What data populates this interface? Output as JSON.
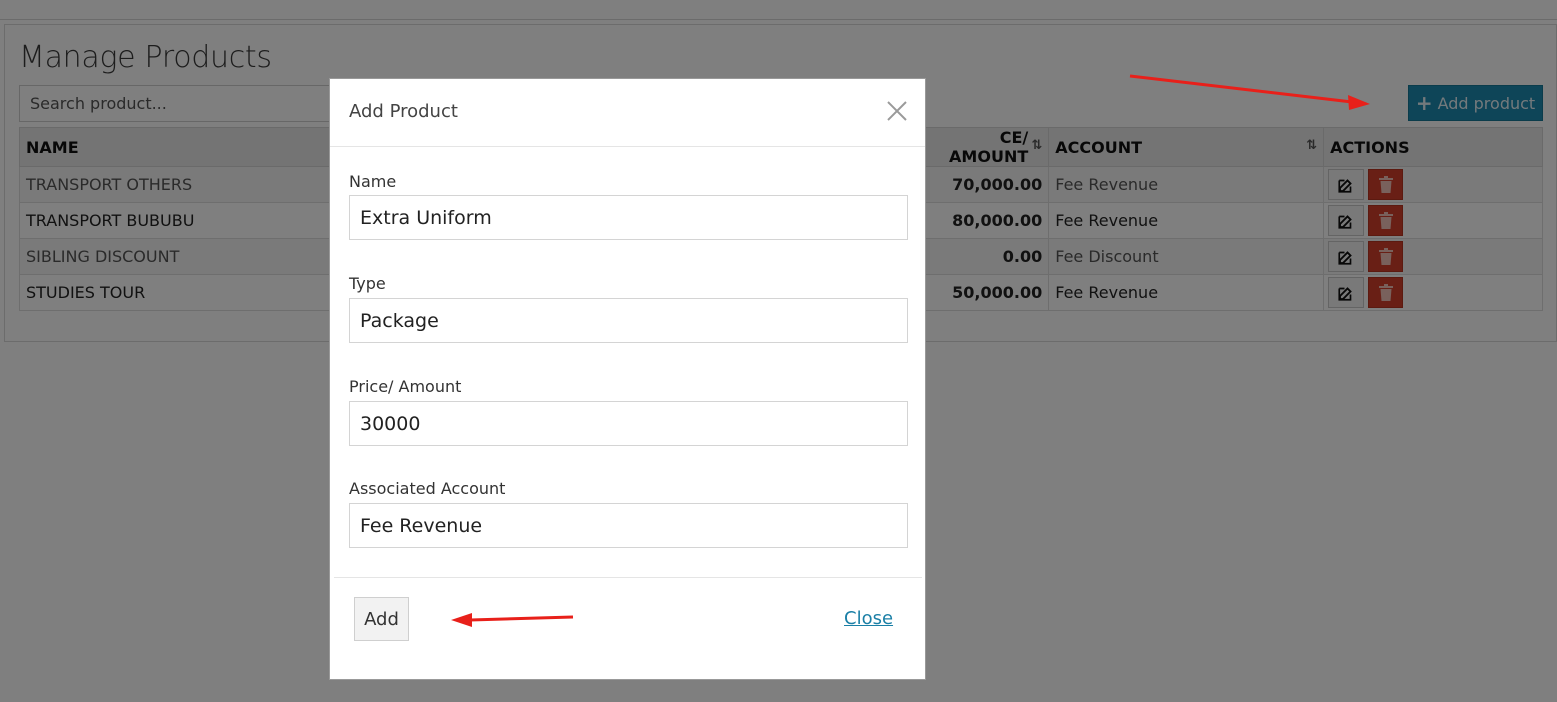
{
  "page": {
    "title": "Manage Products",
    "search_placeholder": "Search product...",
    "add_product_label": "Add product"
  },
  "table": {
    "headers": {
      "name": "NAME",
      "price": "CE/ AMOUNT",
      "account": "ACCOUNT",
      "actions": "ACTIONS"
    },
    "rows": [
      {
        "name": "TRANSPORT OTHERS",
        "amount": "70,000.00",
        "account": "Fee Revenue"
      },
      {
        "name": "TRANSPORT BUBUBU",
        "amount": "80,000.00",
        "account": "Fee Revenue"
      },
      {
        "name": "SIBLING DISCOUNT",
        "amount": "0.00",
        "account": "Fee Discount"
      },
      {
        "name": "STUDIES TOUR",
        "amount": "50,000.00",
        "account": "Fee Revenue"
      }
    ]
  },
  "modal": {
    "title": "Add Product",
    "fields": {
      "name_label": "Name",
      "name_value": "Extra Uniform",
      "type_label": "Type",
      "type_value": "Package",
      "price_label": "Price/ Amount",
      "price_value": "30000",
      "account_label": "Associated Account",
      "account_value": "Fee Revenue"
    },
    "add_label": "Add",
    "close_label": "Close"
  },
  "colors": {
    "accent": "#1c8bb0",
    "amount_green": "#2e9f3e",
    "delete_red": "#d23f2a",
    "annotation_arrow": "#e8201a"
  }
}
